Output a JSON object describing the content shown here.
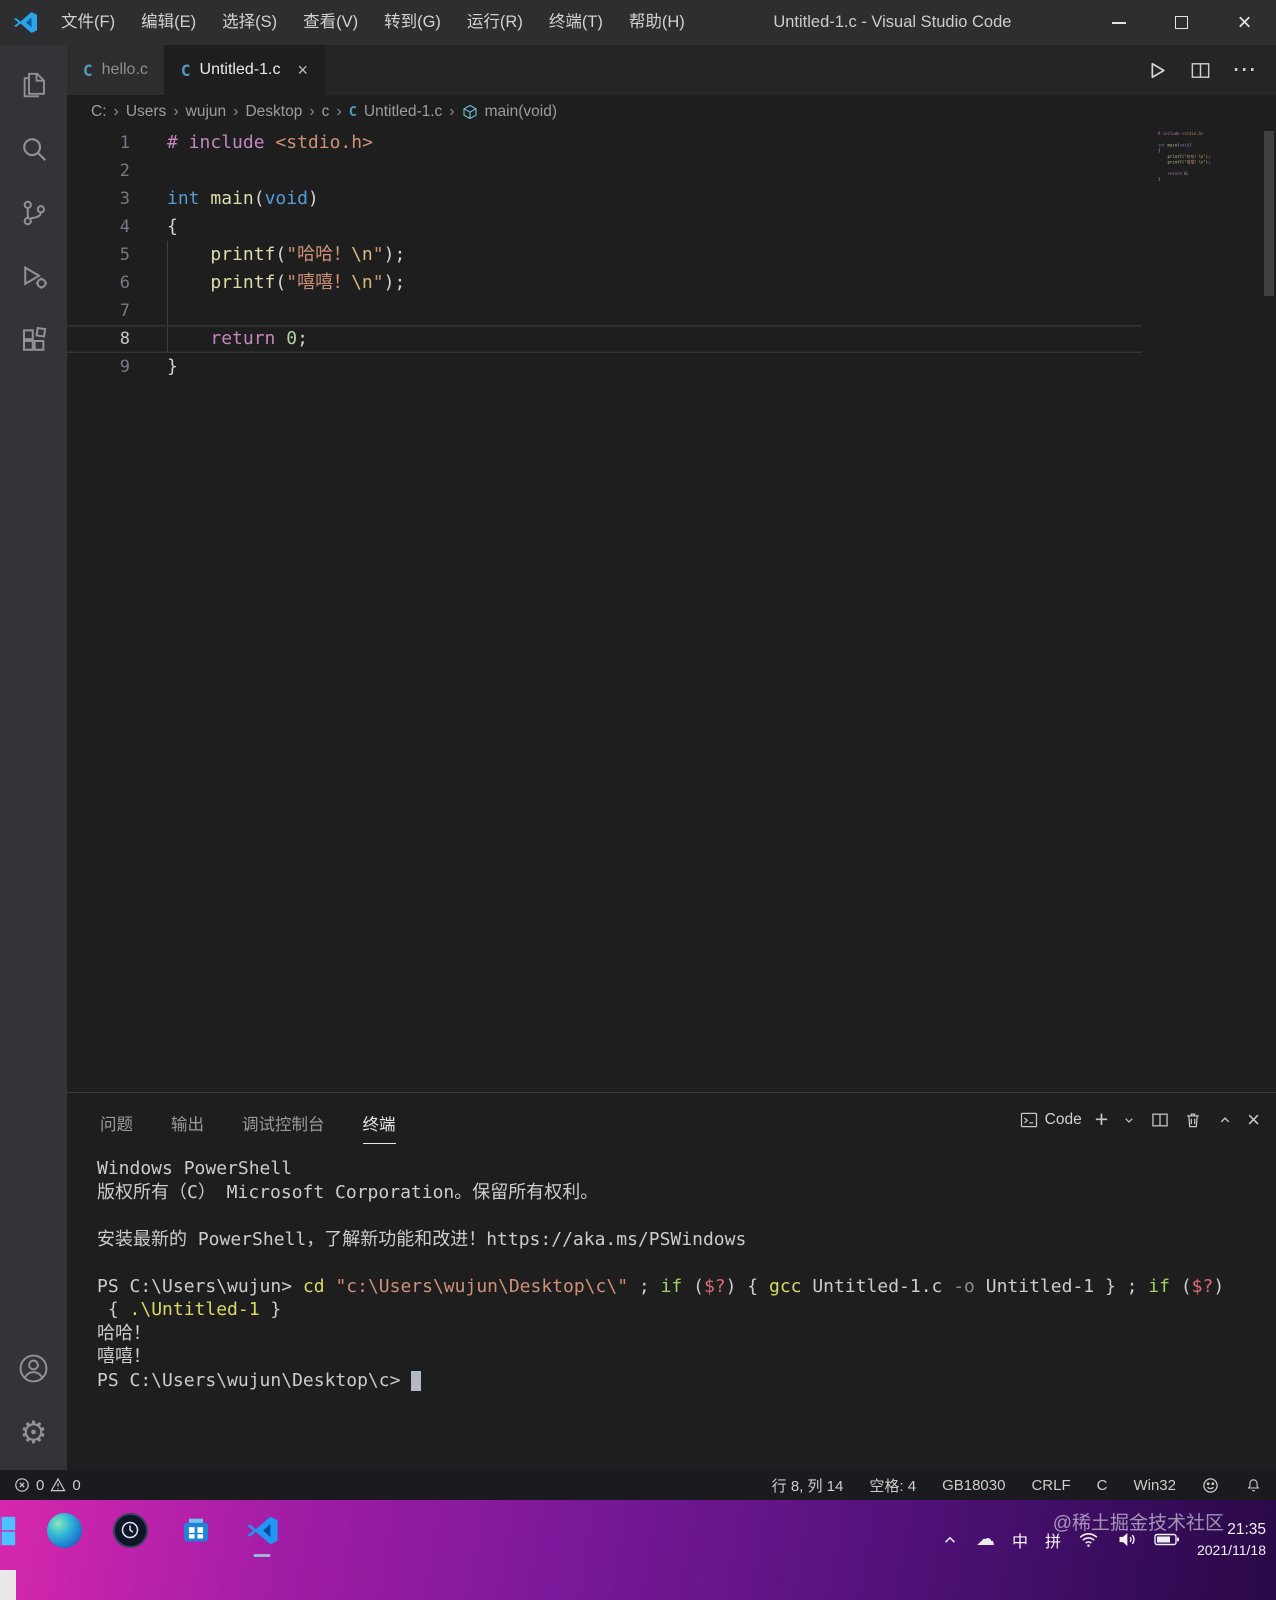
{
  "titlebar": {
    "menus": [
      "文件(F)",
      "编辑(E)",
      "选择(S)",
      "查看(V)",
      "转到(G)",
      "运行(R)",
      "终端(T)",
      "帮助(H)"
    ],
    "title": "Untitled-1.c - Visual Studio Code"
  },
  "tabs": {
    "inactive": {
      "label": "hello.c"
    },
    "active": {
      "label": "Untitled-1.c"
    }
  },
  "breadcrumb": {
    "items": [
      "C:",
      "Users",
      "wujun",
      "Desktop",
      "c"
    ],
    "file": "Untitled-1.c",
    "symbol": "main(void)"
  },
  "editor": {
    "lines": [
      {
        "num": "1",
        "tokens": [
          {
            "t": "# include",
            "c": "pre"
          },
          {
            "t": " ",
            "c": "d"
          },
          {
            "t": "<stdio.h>",
            "c": "str"
          }
        ]
      },
      {
        "num": "2",
        "tokens": []
      },
      {
        "num": "3",
        "tokens": [
          {
            "t": "int",
            "c": "kw"
          },
          {
            "t": " ",
            "c": "d"
          },
          {
            "t": "main",
            "c": "fn"
          },
          {
            "t": "(",
            "c": "d"
          },
          {
            "t": "void",
            "c": "kw"
          },
          {
            "t": ")",
            "c": "d"
          }
        ]
      },
      {
        "num": "4",
        "tokens": [
          {
            "t": "{",
            "c": "d"
          }
        ]
      },
      {
        "num": "5",
        "tokens": [
          {
            "t": "    ",
            "c": "d"
          },
          {
            "t": "printf",
            "c": "fn"
          },
          {
            "t": "(",
            "c": "d"
          },
          {
            "t": "\"哈哈！",
            "c": "str"
          },
          {
            "t": "\\n",
            "c": "esc"
          },
          {
            "t": "\"",
            "c": "str"
          },
          {
            "t": ");",
            "c": "d"
          }
        ]
      },
      {
        "num": "6",
        "tokens": [
          {
            "t": "    ",
            "c": "d"
          },
          {
            "t": "printf",
            "c": "fn"
          },
          {
            "t": "(",
            "c": "d"
          },
          {
            "t": "\"嘻嘻！",
            "c": "str"
          },
          {
            "t": "\\n",
            "c": "esc"
          },
          {
            "t": "\"",
            "c": "str"
          },
          {
            "t": ");",
            "c": "d"
          }
        ]
      },
      {
        "num": "7",
        "tokens": []
      },
      {
        "num": "8",
        "current": true,
        "tokens": [
          {
            "t": "    ",
            "c": "d"
          },
          {
            "t": "return",
            "c": "pre"
          },
          {
            "t": " ",
            "c": "d"
          },
          {
            "t": "0",
            "c": "num"
          },
          {
            "t": ";",
            "c": "d"
          }
        ]
      },
      {
        "num": "9",
        "tokens": [
          {
            "t": "}",
            "c": "d"
          }
        ]
      }
    ]
  },
  "panel": {
    "tabs": [
      "问题",
      "输出",
      "调试控制台",
      "终端"
    ],
    "shell_label": "Code",
    "terminal_lines": [
      {
        "tokens": [
          {
            "t": "Windows PowerShell",
            "c": "d"
          }
        ]
      },
      {
        "tokens": [
          {
            "t": "版权所有（C） Microsoft Corporation。保留所有权利。",
            "c": "d"
          }
        ]
      },
      {
        "tokens": []
      },
      {
        "tokens": [
          {
            "t": "安装最新的 PowerShell，了解新功能和改进！https://aka.ms/PSWindows",
            "c": "d"
          }
        ]
      },
      {
        "tokens": []
      },
      {
        "tokens": [
          {
            "t": "PS C:\\Users\\wujun> ",
            "c": "d"
          },
          {
            "t": "cd",
            "c": "cmd"
          },
          {
            "t": " ",
            "c": "d"
          },
          {
            "t": "\"c:\\Users\\wujun\\Desktop\\c\\\"",
            "c": "str"
          },
          {
            "t": " ; ",
            "c": "d"
          },
          {
            "t": "if",
            "c": "kw"
          },
          {
            "t": " (",
            "c": "d"
          },
          {
            "t": "$?",
            "c": "var"
          },
          {
            "t": ") { ",
            "c": "d"
          },
          {
            "t": "gcc",
            "c": "cmd"
          },
          {
            "t": " Untitled-1.c ",
            "c": "d"
          },
          {
            "t": "-o",
            "c": "par"
          },
          {
            "t": " Untitled-1 } ; ",
            "c": "d"
          },
          {
            "t": "if",
            "c": "kw"
          },
          {
            "t": " (",
            "c": "d"
          },
          {
            "t": "$?",
            "c": "var"
          },
          {
            "t": ")",
            "c": "d"
          }
        ]
      },
      {
        "tokens": [
          {
            "t": " { ",
            "c": "d"
          },
          {
            "t": ".\\Untitled-1",
            "c": "cmd"
          },
          {
            "t": " }",
            "c": "d"
          }
        ]
      },
      {
        "tokens": [
          {
            "t": "哈哈！",
            "c": "d"
          }
        ]
      },
      {
        "tokens": [
          {
            "t": "嘻嘻！",
            "c": "d"
          }
        ]
      },
      {
        "tokens": [
          {
            "t": "PS C:\\Users\\wujun\\Desktop\\c> ",
            "c": "d"
          },
          {
            "t": " ",
            "c": "cursor"
          }
        ]
      }
    ]
  },
  "statusbar": {
    "errors": "0",
    "warnings": "0",
    "cursor_position": "行 8, 列 14",
    "indentation": "空格: 4",
    "encoding": "GB18030",
    "eol": "CRLF",
    "language": "C",
    "platform": "Win32"
  },
  "taskbar": {
    "ime_lang": "中",
    "ime_mode": "拼",
    "time": "21:35",
    "date": "2021/11/18",
    "watermark": "@稀土掘金技术社区"
  }
}
